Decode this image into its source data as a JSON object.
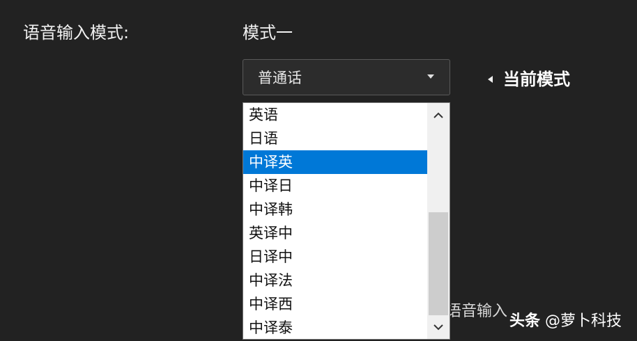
{
  "settings": {
    "label": "语音输入模式:",
    "mode_name": "模式一"
  },
  "select": {
    "value": "普通话",
    "caret_icon": "chevron-down-icon"
  },
  "annotation": {
    "current_mode": "当前模式"
  },
  "dropdown": {
    "options": [
      "英语",
      "日语",
      "中译英",
      "中译日",
      "中译韩",
      "英译中",
      "日译中",
      "中译法",
      "中译西",
      "中译泰"
    ],
    "selected_index": 2,
    "scroll_up_icon": "chevron-up-icon",
    "scroll_down_icon": "chevron-down-icon",
    "highlight_color": "#0078d7"
  },
  "background_text": "语音输入",
  "watermark": {
    "brand": "头条",
    "handle": "@萝卜科技"
  }
}
